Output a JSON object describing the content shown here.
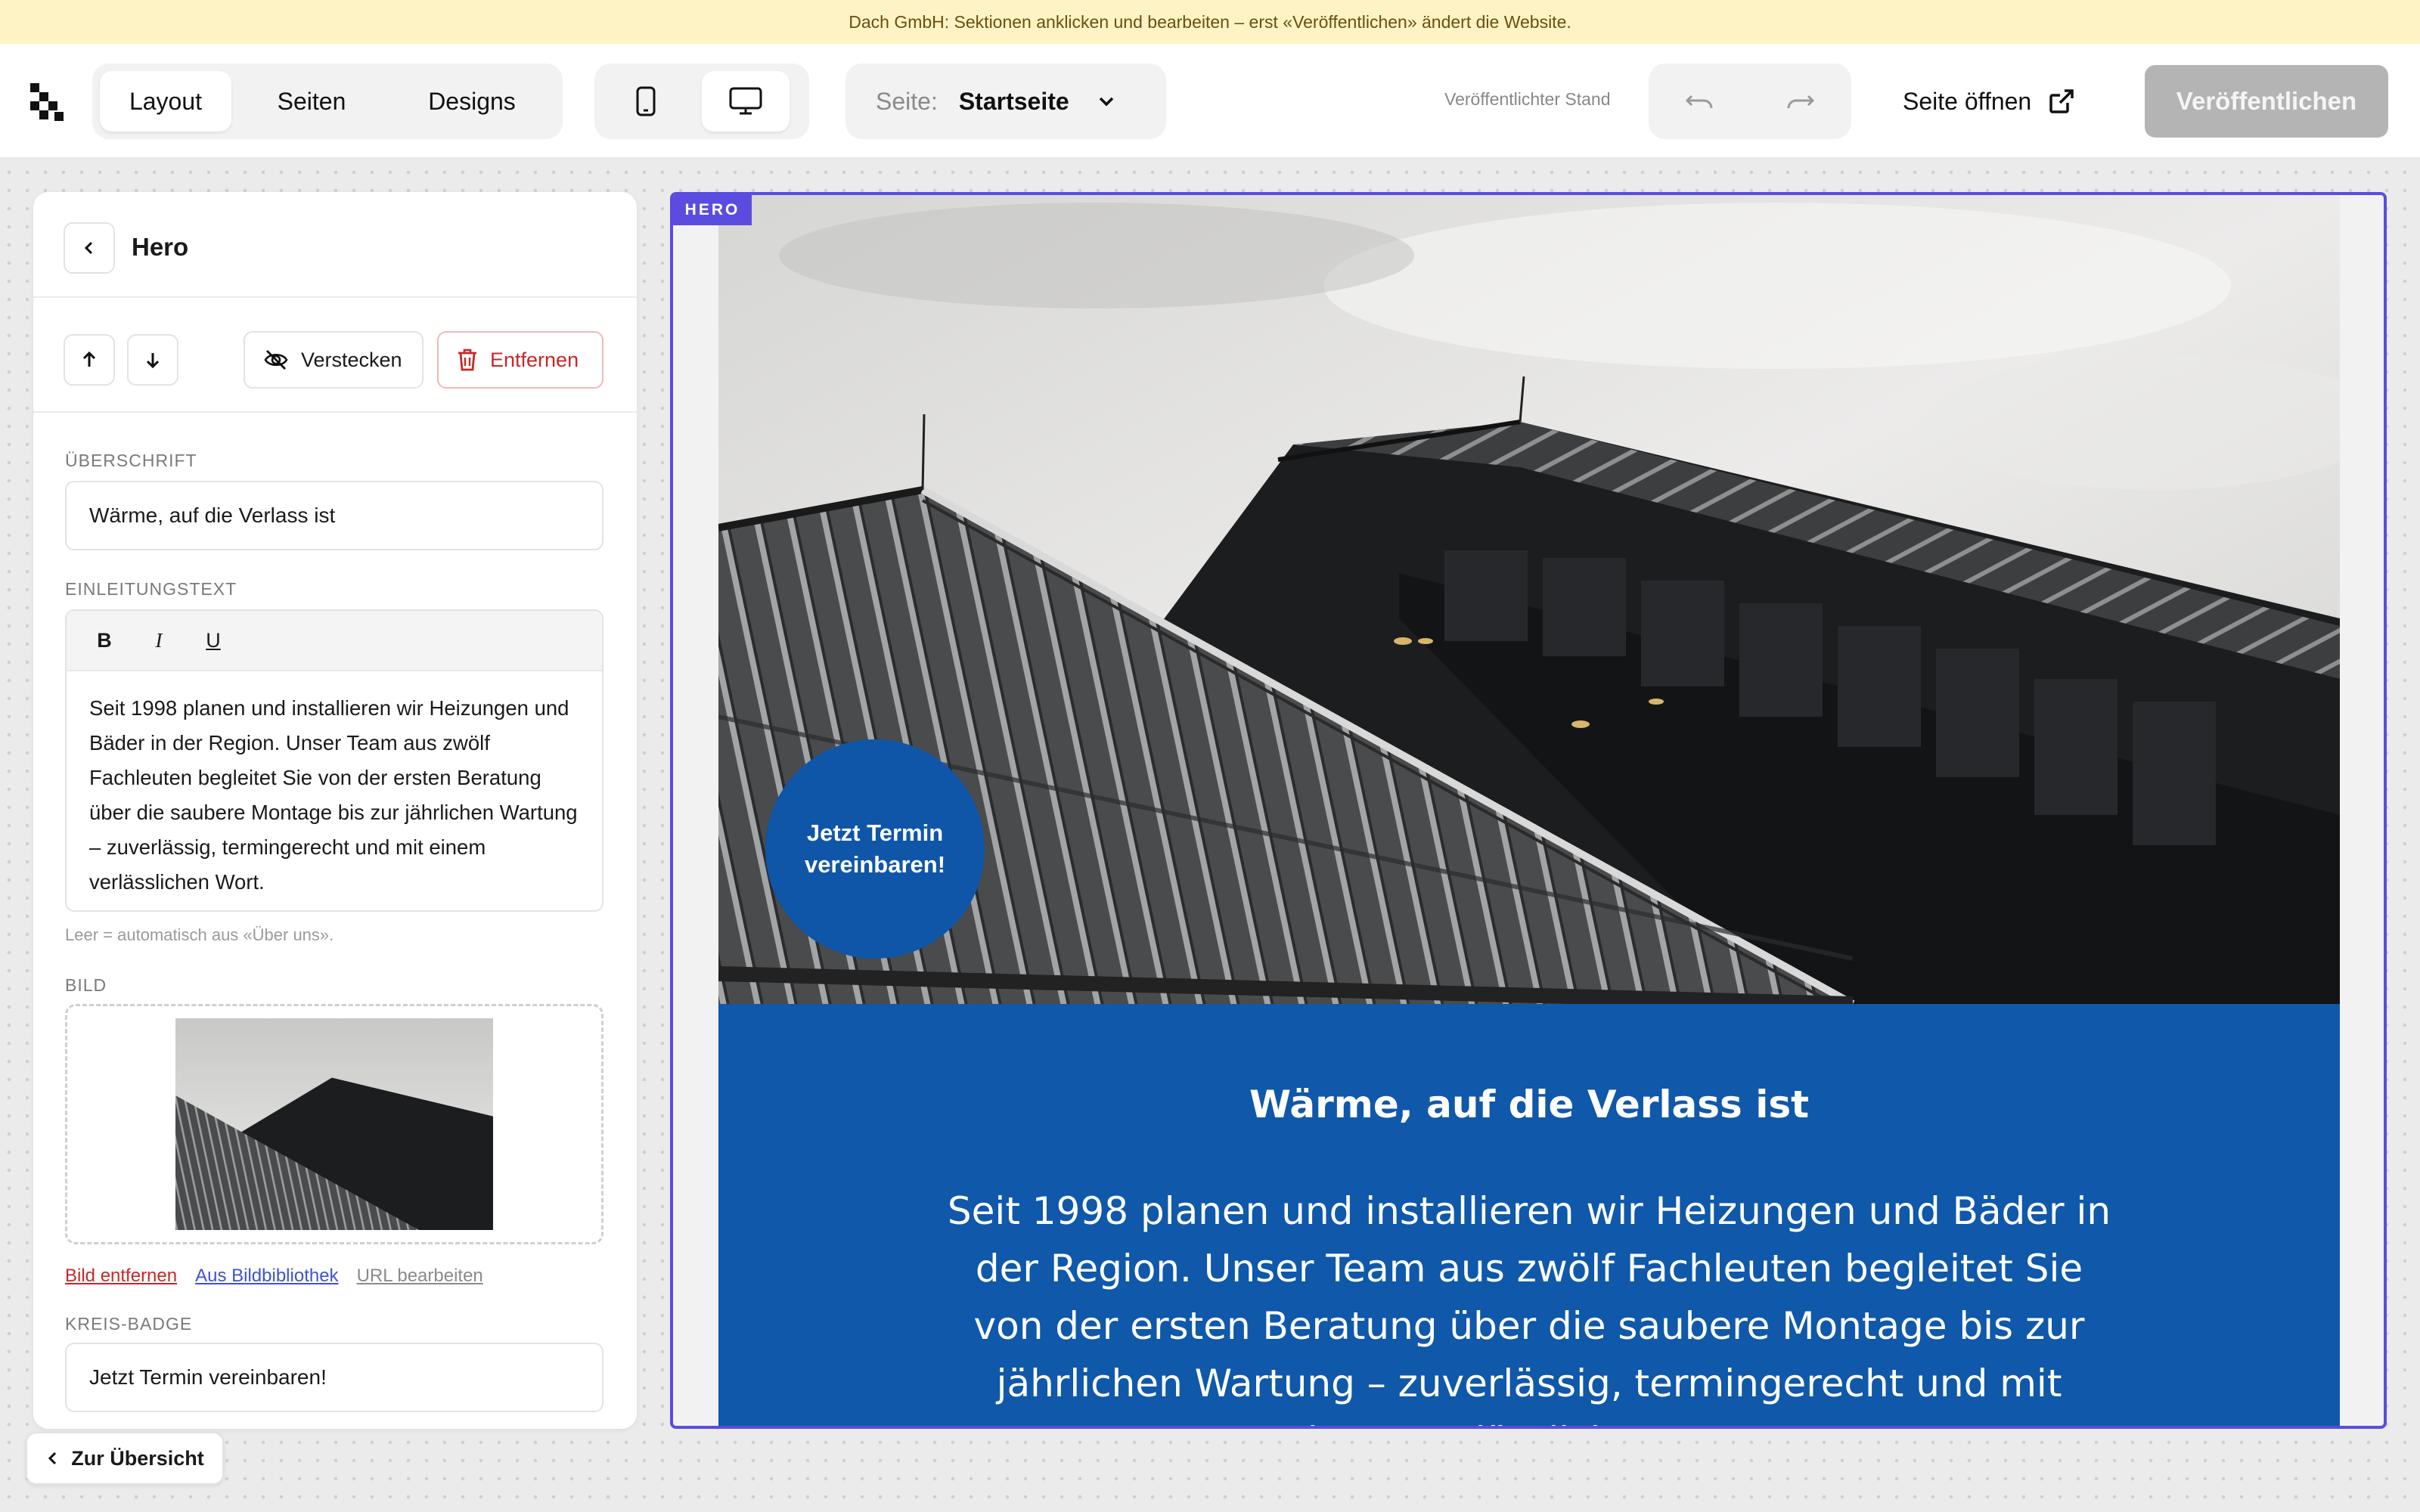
{
  "banner": "Dach GmbH: Sektionen anklicken und bearbeiten – erst «Veröffentlichen» ändert die Website.",
  "topbar": {
    "mode_tabs": [
      "Layout",
      "Seiten",
      "Designs"
    ],
    "active_tab": "Layout",
    "device_icons": [
      "mobile-icon",
      "desktop-icon"
    ],
    "active_device": "desktop",
    "page_label": "Seite:",
    "page_value": "Startseite",
    "published_state": "Veröffentlichter Stand",
    "open_page": "Seite öffnen",
    "publish": "Veröffentlichen"
  },
  "panel": {
    "title": "Hero",
    "hide": "Verstecken",
    "remove": "Entfernen",
    "heading_label": "ÜBERSCHRIFT",
    "heading_value": "Wärme, auf die Verlass ist",
    "intro_label": "EINLEITUNGSTEXT",
    "format_buttons": [
      "B",
      "I",
      "U"
    ],
    "intro_value": "Seit 1998 planen und installieren wir Heizungen und Bäder in der Region. Unser Team aus zwölf Fachleuten begleitet Sie von der ersten Beratung über die saubere Montage bis zur jährlichen Wartung – zuverlässig, termingerecht und mit einem verlässlichen Wort.",
    "intro_hint": "Leer = automatisch aus «Über uns».",
    "image_label": "BILD",
    "image_links": [
      "Bild entfernen",
      "Aus Bildbibliothek",
      "URL bearbeiten"
    ],
    "badge_label": "KREIS-BADGE",
    "badge_value": "Jetzt Termin vereinbaren!"
  },
  "preview": {
    "section_tag": "HERO",
    "badge": "Jetzt Termin vereinbaren!",
    "heading": "Wärme, auf die Verlass ist",
    "intro": "Seit 1998 planen und installieren wir Heizungen und Bäder in der Region. Unser Team aus zwölf Fachleuten begleitet Sie von der ersten Beratung über die saubere Montage bis zur jährlichen Wartung – zuverlässig, termingerecht und mit einem verlässlichen Wort."
  },
  "overview_button": "Zur Übersicht",
  "colors": {
    "accent": "#5b4ce0",
    "hero_blue": "#0f58aa",
    "danger": "#c62828",
    "banner": "#fdf3c4"
  }
}
